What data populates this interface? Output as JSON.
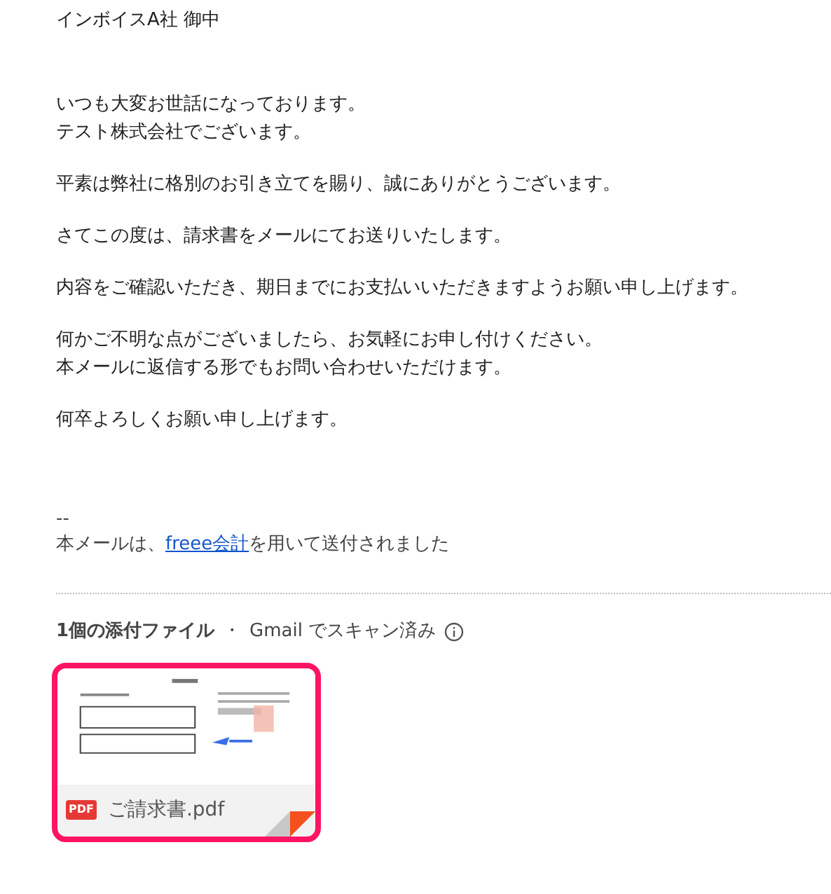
{
  "greeting": "インボイスA社 御中",
  "paragraphs": [
    [
      "いつも大変お世話になっております。",
      "テスト株式会社でございます。"
    ],
    [
      "平素は弊社に格別のお引き立てを賜り、誠にありがとうございます。"
    ],
    [
      "さてこの度は、請求書をメールにてお送りいたします。"
    ],
    [
      "内容をご確認いただき、期日までにお支払いいただきますようお願い申し上げます。"
    ],
    [
      "何かご不明な点がございましたら、お気軽にお申し付けください。",
      "本メールに返信する形でもお問い合わせいただけます。"
    ],
    [
      "何卒よろしくお願い申し上げます。"
    ]
  ],
  "signature": {
    "separator": "--",
    "before": "本メールは、",
    "link": "freee会計",
    "after": "を用いて送付されました"
  },
  "attachments_header": {
    "count": "1個の添付ファイル",
    "dot": "・",
    "scan": "Gmail でスキャン済み"
  },
  "attachments": [
    {
      "badge": "PDF",
      "filename": "ご請求書.pdf",
      "selected": true
    }
  ]
}
